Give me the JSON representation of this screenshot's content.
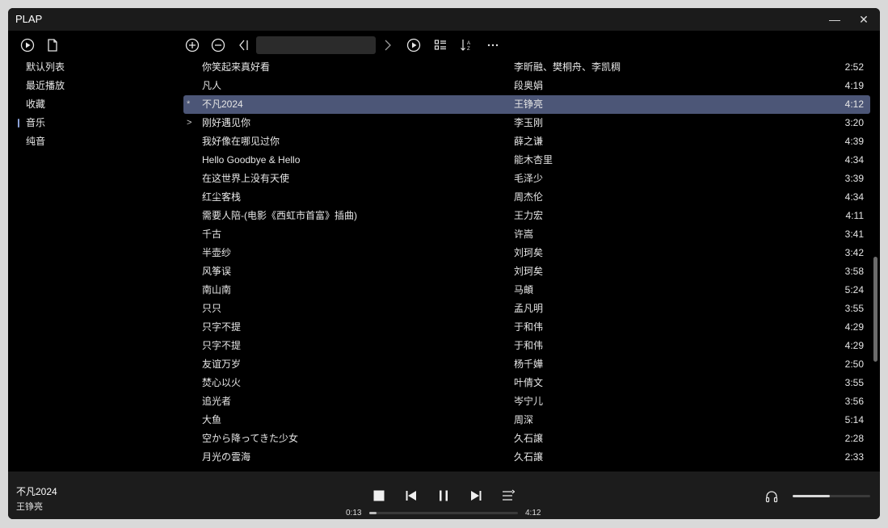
{
  "app": {
    "title": "PLAP"
  },
  "window_controls": {
    "minimize": "—",
    "close": "✕"
  },
  "search": {
    "value": "",
    "placeholder": ""
  },
  "sidebar": {
    "items": [
      {
        "label": "默认列表",
        "active": false
      },
      {
        "label": "最近播放",
        "active": false
      },
      {
        "label": "收藏",
        "active": false
      },
      {
        "label": "音乐",
        "active": true
      },
      {
        "label": "纯音",
        "active": false
      }
    ]
  },
  "songs": [
    {
      "mark": "",
      "title": "你笑起来真好看",
      "artist": "李昕融、樊桐舟、李凯稠",
      "duration": "2:52"
    },
    {
      "mark": "",
      "title": "凡人",
      "artist": "段奥娟",
      "duration": "4:19"
    },
    {
      "mark": "*",
      "title": "不凡2024",
      "artist": "王铮亮",
      "duration": "4:12",
      "selected": true
    },
    {
      "mark": ">",
      "title": "刚好遇见你",
      "artist": "李玉刚",
      "duration": "3:20"
    },
    {
      "mark": "",
      "title": "我好像在哪见过你",
      "artist": "薛之谦",
      "duration": "4:39"
    },
    {
      "mark": "",
      "title": "Hello Goodbye & Hello",
      "artist": "能木杏里",
      "duration": "4:34"
    },
    {
      "mark": "",
      "title": "在这世界上没有天使",
      "artist": "毛泽少",
      "duration": "3:39"
    },
    {
      "mark": "",
      "title": "红尘客栈",
      "artist": "周杰伦",
      "duration": "4:34"
    },
    {
      "mark": "",
      "title": "需要人陪-(电影《西虹市首富》插曲)",
      "artist": "王力宏",
      "duration": "4:11"
    },
    {
      "mark": "",
      "title": "千古",
      "artist": "许嵩",
      "duration": "3:41"
    },
    {
      "mark": "",
      "title": "半壶纱",
      "artist": "刘珂矣",
      "duration": "3:42"
    },
    {
      "mark": "",
      "title": "风筝误",
      "artist": "刘珂矣",
      "duration": "3:58"
    },
    {
      "mark": "",
      "title": "南山南",
      "artist": "马頔",
      "duration": "5:24"
    },
    {
      "mark": "",
      "title": "只只",
      "artist": "孟凡明",
      "duration": "3:55"
    },
    {
      "mark": "",
      "title": "只字不提",
      "artist": "于和伟",
      "duration": "4:29"
    },
    {
      "mark": "",
      "title": "只字不提",
      "artist": "于和伟",
      "duration": "4:29"
    },
    {
      "mark": "",
      "title": "友谊万岁",
      "artist": "杨千嬅",
      "duration": "2:50"
    },
    {
      "mark": "",
      "title": "焚心以火",
      "artist": "叶倩文",
      "duration": "3:55"
    },
    {
      "mark": "",
      "title": "追光者",
      "artist": "岑宁儿",
      "duration": "3:56"
    },
    {
      "mark": "",
      "title": "大鱼",
      "artist": "周深",
      "duration": "5:14"
    },
    {
      "mark": "",
      "title": "空から降ってきた少女",
      "artist": "久石譲",
      "duration": "2:28"
    },
    {
      "mark": "",
      "title": "月光の雲海",
      "artist": "久石譲",
      "duration": "2:33"
    }
  ],
  "player": {
    "now_title": "不凡2024",
    "now_artist": "王铮亮",
    "elapsed": "0:13",
    "total": "4:12",
    "progress": 0.05,
    "volume": 0.48
  },
  "colors": {
    "accent": "#4c5677",
    "indicator": "#8aa0d6"
  }
}
